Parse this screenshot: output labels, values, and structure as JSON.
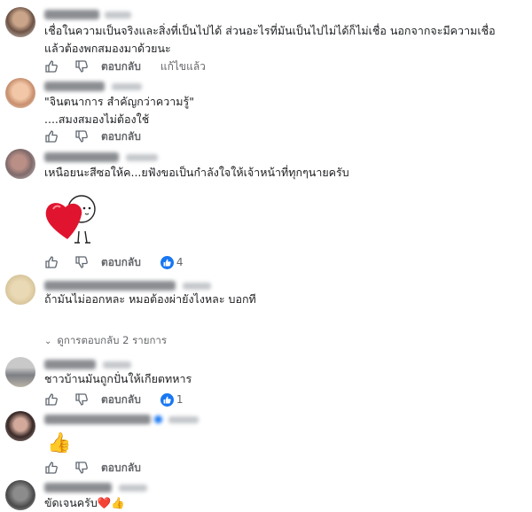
{
  "actions": {
    "reply_label": "ตอบกลับ",
    "edited_label": "แก้ไขแล้ว"
  },
  "comments": [
    {
      "lines": [
        "เชื่อในความเป็นจริงและสิ่งที่เป็นไปได้ ส่วนอะไรที่มันเป็นไปไม่ได้ก็ไม่เชื่อ นอกจากจะมีความเชื่อ",
        "แล้วต้องพกสมองมาด้วยนะ"
      ],
      "edited": true
    },
    {
      "lines": [
        "\"จินตนาการ สำคัญกว่าความรู้\"",
        "....สมงสมองไม่ต้องใช้"
      ]
    },
    {
      "lines": [
        "เหนือยนะสีซอให้ค...ยฟังขอเป็นกำลังใจให้เจ้าหน้าที่ทุกๆนายครับ"
      ],
      "sticker": "heart-hug-sticker",
      "reaction_count": "4"
    },
    {
      "lines": [
        "ถ้ามันไม่ออกหละ หมอต้องผ่ายังไงหละ บอกที"
      ],
      "replies_label": "ดูการตอบกลับ 2 รายการ"
    },
    {
      "lines": [
        "ชาวบ้านมันถูกปั่นให้เกียตทหาร"
      ],
      "reaction_count": "1"
    },
    {
      "lines": [
        ""
      ],
      "emoji": "👍"
    },
    {
      "lines": [
        "ขัดเจนครับ❤️👍"
      ]
    }
  ],
  "colors": {
    "secondary_text": "#65676b",
    "reaction_blue": "#1877f2",
    "heart_red": "#e0142e"
  }
}
